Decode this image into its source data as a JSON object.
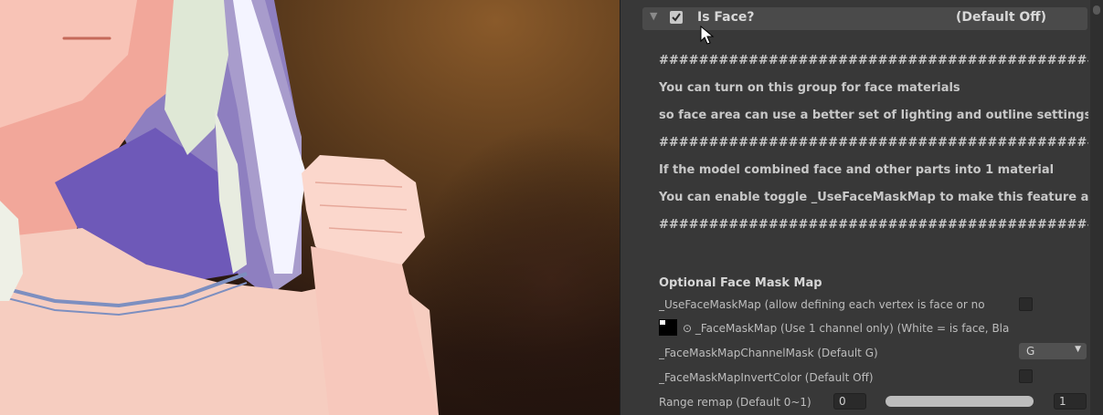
{
  "header": {
    "title": "Is Face?",
    "suffix": "(Default Off)",
    "enabled": true
  },
  "help_lines": [
    "#################################################################",
    "You can turn on this group for face materials",
    "so face area can use a better set of lighting and outline settings a",
    "#################################################################",
    "If the model combined face and other parts into 1 material",
    "You can enable toggle _UseFaceMaskMap to make this feature a",
    "#################################################################"
  ],
  "section": {
    "title": "Optional Face Mask Map"
  },
  "props": {
    "use_mask": "_UseFaceMaskMap (allow defining each vertex is face or no",
    "mask_map": "⊙ _FaceMaskMap (Use 1 channel only) (White = is face, Bla",
    "channel_mask": "_FaceMaskMapChannelMask (Default G)",
    "channel_value": "G",
    "invert": "_FaceMaskMapInvertColor (Default Off)",
    "remap": "Range remap (Default 0~1)",
    "remap_min": "0",
    "remap_max": "1"
  },
  "icons": {
    "foldout": "foldout-arrow-icon",
    "checkbox": "checkmark-icon",
    "cursor": "mouse-pointer-icon"
  },
  "colors": {
    "panel": "#383838",
    "header": "#4a4a4a",
    "text": "#c8c8c8"
  }
}
